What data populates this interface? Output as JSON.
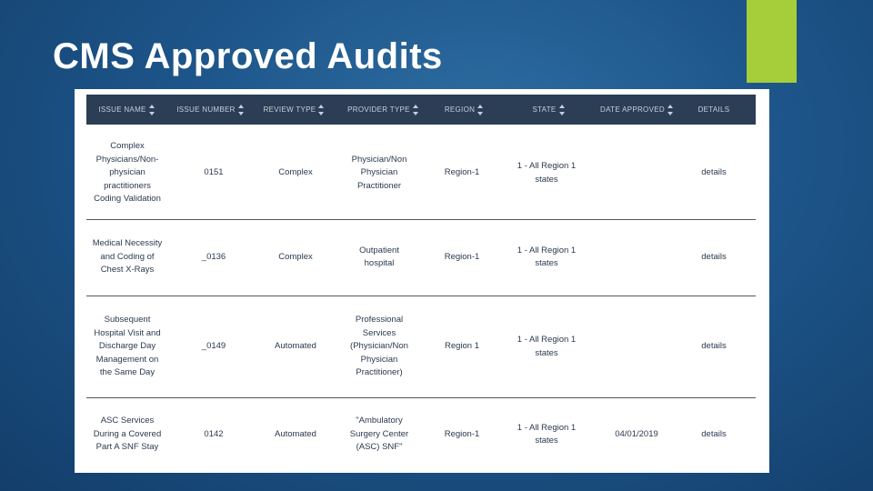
{
  "slide": {
    "title": "CMS Approved Audits",
    "accent_color": "#a6cd3a",
    "background_color": "#1d558a"
  },
  "table": {
    "header_color": "#2c3e55",
    "columns": [
      {
        "label": "ISSUE NAME",
        "sortable": true
      },
      {
        "label": "ISSUE NUMBER",
        "sortable": true
      },
      {
        "label": "REVIEW TYPE",
        "sortable": true
      },
      {
        "label": "PROVIDER TYPE",
        "sortable": true
      },
      {
        "label": "REGION",
        "sortable": true
      },
      {
        "label": "STATE",
        "sortable": true
      },
      {
        "label": "DATE APPROVED",
        "sortable": true
      },
      {
        "label": "DETAILS",
        "sortable": false
      }
    ],
    "rows": [
      {
        "issue_name": "Complex Physicians/Non-physician practitioners Coding Validation",
        "issue_number": "0151",
        "review_type": "Complex",
        "provider_type": "Physician/Non Physician Practitioner",
        "region": "Region-1",
        "state": "1 - All Region 1 states",
        "date_approved": "",
        "details": "details"
      },
      {
        "issue_name": "Medical Necessity and Coding of Chest X-Rays",
        "issue_number": "_0136",
        "review_type": "Complex",
        "provider_type": "Outpatient hospital",
        "region": "Region-1",
        "state": "1 - All Region 1 states",
        "date_approved": "",
        "details": "details"
      },
      {
        "issue_name": "Subsequent Hospital Visit and Discharge Day Management on the Same Day",
        "issue_number": "_0149",
        "review_type": "Automated",
        "provider_type": "Professional Services (Physician/Non Physician Practitioner)",
        "region": "Region 1",
        "state": "1 - All Region 1 states",
        "date_approved": "",
        "details": "details"
      },
      {
        "issue_name": "ASC Services During a Covered Part A SNF Stay",
        "issue_number": "0142",
        "review_type": "Automated",
        "provider_type": "\"Ambulatory Surgery Center (ASC) SNF\"",
        "region": "Region-1",
        "state": "1 - All Region 1 states",
        "date_approved": "04/01/2019",
        "details": "details"
      }
    ]
  }
}
